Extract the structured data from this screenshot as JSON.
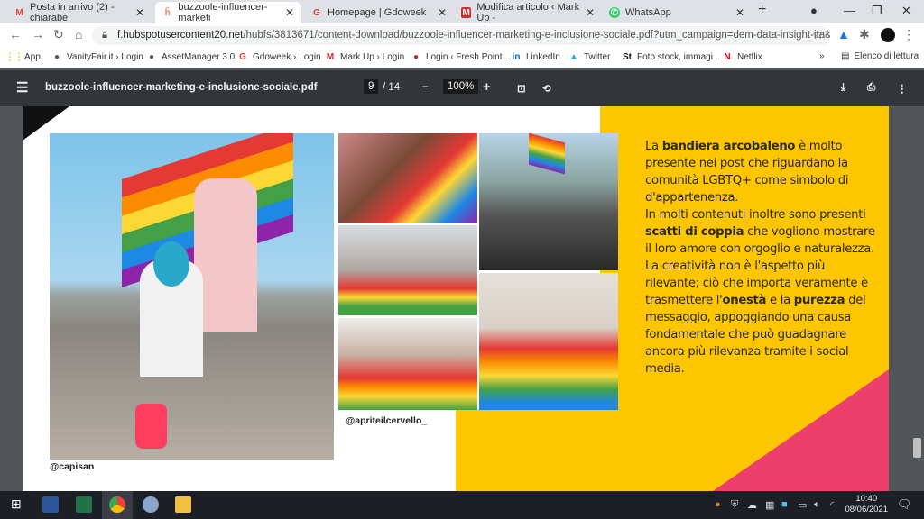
{
  "tabs": [
    {
      "label": "Posta in arrivo (2) - chiarabe",
      "icon": "gmail-icon",
      "color": "#ea4335",
      "glyph": "M"
    },
    {
      "label": "buzzoole-influencer-marketi",
      "icon": "hubspot-icon",
      "color": "#ff7a59",
      "glyph": "h"
    },
    {
      "label": "Homepage | Gdoweek",
      "icon": "gdoweek-icon",
      "color": "#e53935",
      "glyph": "G"
    },
    {
      "label": "Modifica articolo ‹ Mark Up -",
      "icon": "markup-icon",
      "color": "#d32f2f",
      "glyph": "M"
    },
    {
      "label": "WhatsApp",
      "icon": "whatsapp-icon",
      "color": "#25d366",
      "glyph": "✆"
    }
  ],
  "address": {
    "host": "f.hubspotusercontent20.net",
    "path": "/hubfs/3813671/content-download/buzzoole-influencer-marketing-e-inclusione-sociale.pdf?utm_campaign=dem-data-insight-ita&ut..."
  },
  "bookmarks": [
    {
      "label": "App",
      "color": "#f4b400",
      "glyph": "⋮⋮"
    },
    {
      "label": "VanityFair.it › Login",
      "color": "#555",
      "glyph": "●"
    },
    {
      "label": "AssetManager 3.0",
      "color": "#555",
      "glyph": "●"
    },
    {
      "label": "Gdoweek › Login",
      "color": "#e53935",
      "glyph": "G"
    },
    {
      "label": "Mark Up › Login",
      "color": "#d32f2f",
      "glyph": "M"
    },
    {
      "label": "Login ‹ Fresh Point...",
      "color": "#c62828",
      "glyph": "●"
    },
    {
      "label": "LinkedIn",
      "color": "#0a66c2",
      "glyph": "in"
    },
    {
      "label": "Twitter",
      "color": "#1da1f2",
      "glyph": "▲"
    },
    {
      "label": "Foto stock, immagi...",
      "color": "#111",
      "glyph": "St"
    },
    {
      "label": "Netflix",
      "color": "#e50914",
      "glyph": "N"
    }
  ],
  "reading_list": "Elenco di lettura",
  "more_bookmarks": "»",
  "pdf": {
    "title": "buzzoole-influencer-marketing-e-inclusione-sociale.pdf",
    "page": "9",
    "total": "/ 14",
    "zoom": "100%"
  },
  "slide": {
    "caption_left": "@capisan",
    "caption_right": "@apriteilcervello_",
    "p1": [
      "La ",
      "bandiera arcobaleno",
      " è molto presente nei post che riguardano la comunità LGBTQ+ come simbolo di d'appartenenza."
    ],
    "p2": [
      "In molti contenuti inoltre sono presenti ",
      "scatti di coppia",
      " che vogliono mostrare il loro amore con orgoglio e naturalezza."
    ],
    "p3": [
      "La creatività non è l'aspetto più rilevante; ciò che importa veramente è trasmettere l'",
      "onestà",
      " e la ",
      "purezza",
      " del messaggio, appoggiando una causa fondamentale che può guadagnare ancora più rilevanza tramite i social media."
    ]
  },
  "clock": {
    "time": "10:40",
    "date": "08/06/2021"
  },
  "colors": {
    "yellow": "#fec600",
    "pink": "#ec3f6b"
  }
}
